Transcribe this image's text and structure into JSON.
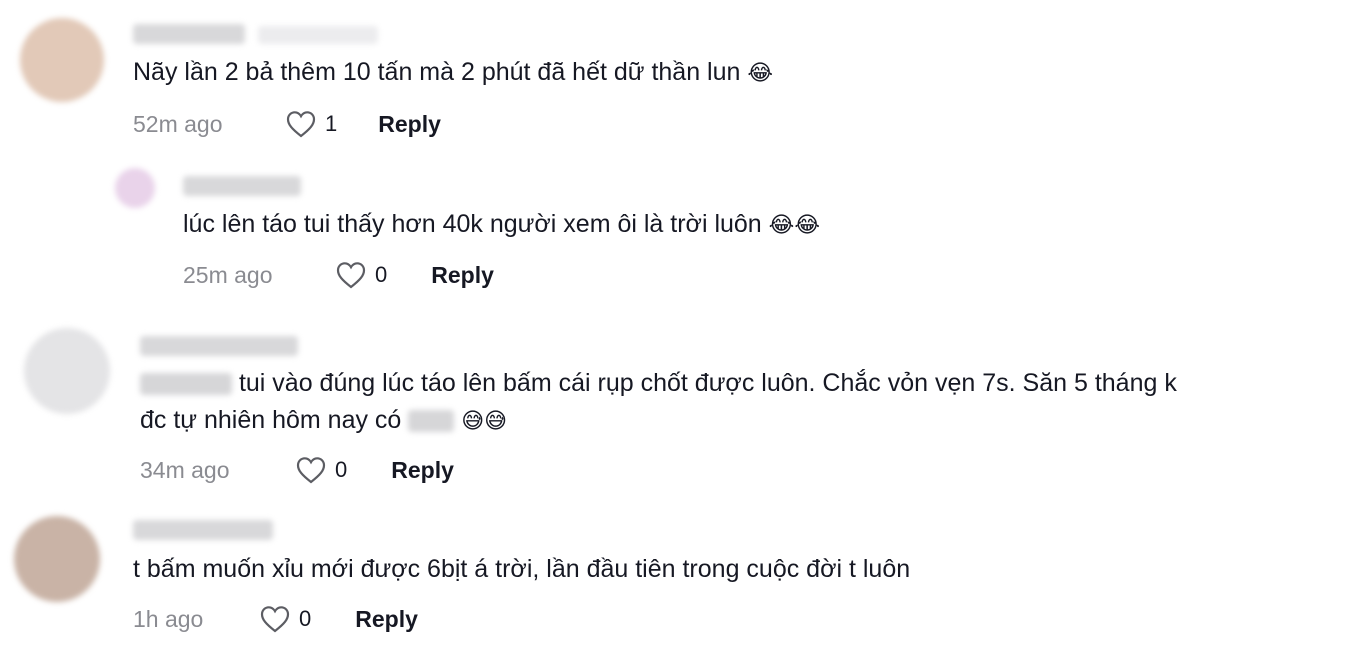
{
  "comments": [
    {
      "text": "Nãy lần 2 bả thêm 10 tấn mà 2 phút đã hết dữ thần lun",
      "emoji": "😂",
      "time": "52m ago",
      "likes": "1",
      "reply_label": "Reply",
      "avatar_color": "#e2c9b8"
    },
    {
      "text": "lúc lên táo tui thấy hơn 40k người xem ôi là trời luôn",
      "emoji": "😂😂",
      "time": "25m ago",
      "likes": "0",
      "reply_label": "Reply",
      "avatar_color": "#e9d3ea"
    },
    {
      "text_line1": "tui vào đúng lúc táo lên bấm cái rụp chốt được luôn. Chắc vỏn vẹn 7s. Săn 5 tháng k",
      "text_line2": "đc tự nhiên hôm nay có",
      "emoji": "😅😅",
      "time": "34m ago",
      "likes": "0",
      "reply_label": "Reply",
      "avatar_color": "#e4e4e6"
    },
    {
      "text": "t bấm muốn xỉu mới được 6bịt á trời, lần đầu tiên trong cuộc đời t luôn",
      "time": "1h ago",
      "likes": "0",
      "reply_label": "Reply",
      "avatar_color": "#c9b3a6"
    }
  ],
  "icons": {
    "like": "heart-outline-icon"
  },
  "colors": {
    "time": "#8a8b91",
    "text": "#161823",
    "icon_stroke": "#5c5d63"
  }
}
